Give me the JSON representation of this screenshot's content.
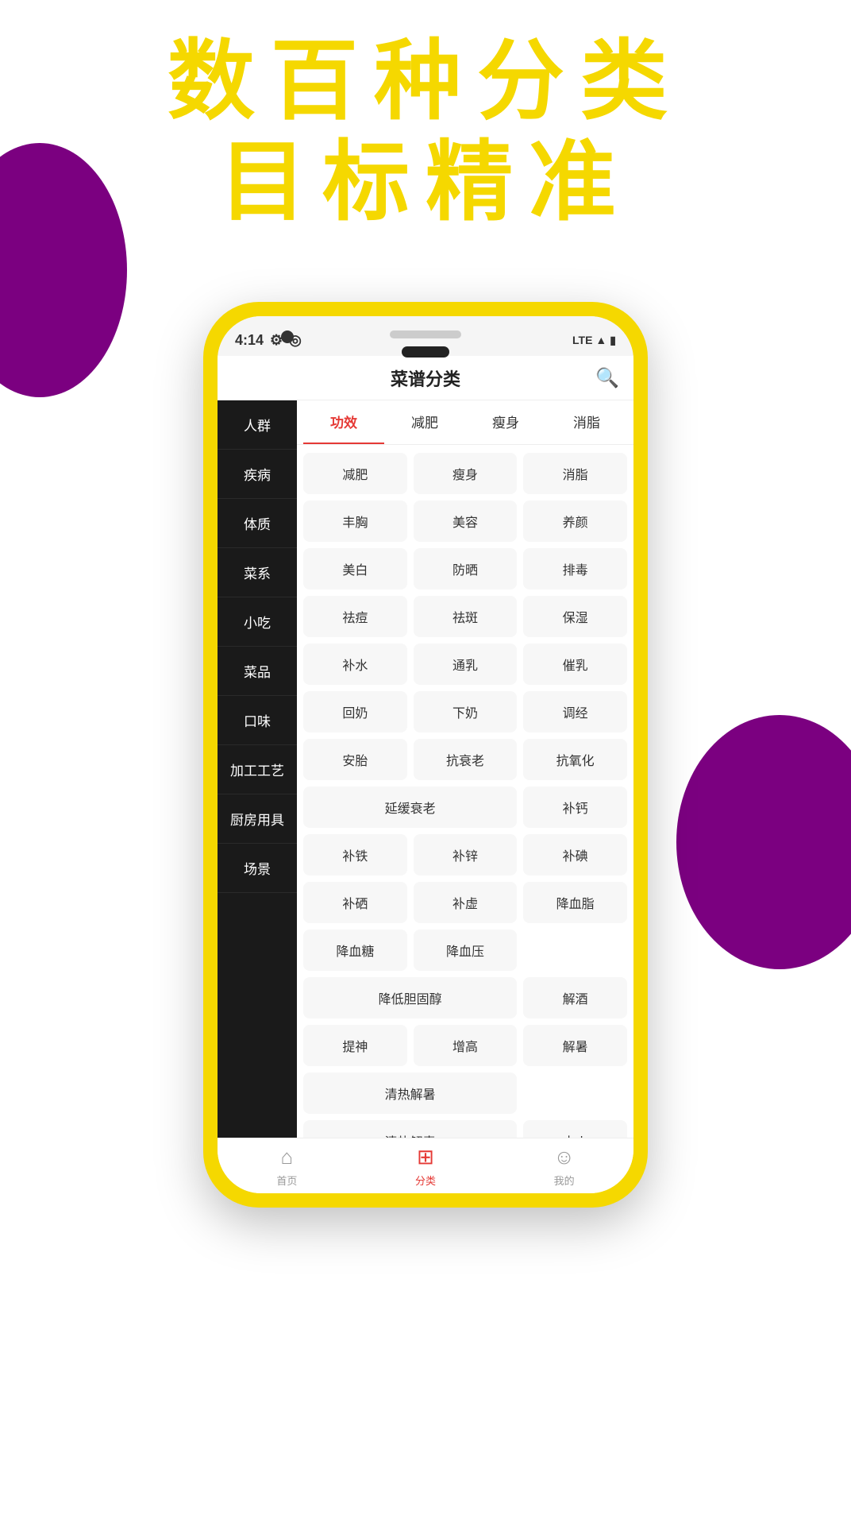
{
  "hero": {
    "line1": "数百种分类",
    "line2": "目标精准"
  },
  "status_bar": {
    "time": "4:14",
    "signal": "LTE",
    "settings_icon": "⚙",
    "location_icon": "◎"
  },
  "header": {
    "title": "菜谱分类",
    "search_label": "搜索"
  },
  "sidebar": {
    "items": [
      {
        "label": "人群",
        "active": false
      },
      {
        "label": "疾病",
        "active": false
      },
      {
        "label": "体质",
        "active": false
      },
      {
        "label": "菜系",
        "active": false
      },
      {
        "label": "小吃",
        "active": false
      },
      {
        "label": "菜品",
        "active": false
      },
      {
        "label": "口味",
        "active": false
      },
      {
        "label": "加工工艺",
        "active": false
      },
      {
        "label": "厨房用具",
        "active": false
      },
      {
        "label": "场景",
        "active": false
      }
    ]
  },
  "top_tabs": [
    {
      "label": "功效",
      "active": true
    },
    {
      "label": "减肥",
      "active": false
    },
    {
      "label": "瘦身",
      "active": false
    },
    {
      "label": "消脂",
      "active": false
    }
  ],
  "tags": [
    {
      "label": "减肥",
      "wide": false
    },
    {
      "label": "瘦身",
      "wide": false
    },
    {
      "label": "消脂",
      "wide": false
    },
    {
      "label": "丰胸",
      "wide": false
    },
    {
      "label": "美容",
      "wide": false
    },
    {
      "label": "养颜",
      "wide": false
    },
    {
      "label": "美白",
      "wide": false
    },
    {
      "label": "防晒",
      "wide": false
    },
    {
      "label": "排毒",
      "wide": false
    },
    {
      "label": "祛痘",
      "wide": false
    },
    {
      "label": "祛斑",
      "wide": false
    },
    {
      "label": "保湿",
      "wide": false
    },
    {
      "label": "补水",
      "wide": false
    },
    {
      "label": "通乳",
      "wide": false
    },
    {
      "label": "催乳",
      "wide": false
    },
    {
      "label": "回奶",
      "wide": false
    },
    {
      "label": "下奶",
      "wide": false
    },
    {
      "label": "调经",
      "wide": false
    },
    {
      "label": "安胎",
      "wide": false
    },
    {
      "label": "抗衰老",
      "wide": false
    },
    {
      "label": "抗氧化",
      "wide": false
    },
    {
      "label": "延缓衰老",
      "wide": false
    },
    {
      "label": "补钙",
      "wide": false
    },
    {
      "label": "补铁",
      "wide": false
    },
    {
      "label": "补锌",
      "wide": false
    },
    {
      "label": "补碘",
      "wide": false
    },
    {
      "label": "补硒",
      "wide": false
    },
    {
      "label": "补虚",
      "wide": false
    },
    {
      "label": "降血脂",
      "wide": false
    },
    {
      "label": "降血糖",
      "wide": false
    },
    {
      "label": "降血压",
      "wide": false
    },
    {
      "label": "降低胆固醇",
      "wide": false
    },
    {
      "label": "解酒",
      "wide": false
    },
    {
      "label": "提神",
      "wide": false
    },
    {
      "label": "增高",
      "wide": false
    },
    {
      "label": "解暑",
      "wide": false
    },
    {
      "label": "清热解暑",
      "wide": false
    },
    {
      "label": "清热解毒",
      "wide": false
    },
    {
      "label": "去火",
      "wide": false
    }
  ],
  "bottom_nav": {
    "items": [
      {
        "label": "首页",
        "icon": "⌂",
        "active": false
      },
      {
        "label": "分类",
        "icon": "⊞",
        "active": true
      },
      {
        "label": "我的",
        "icon": "☺",
        "active": false
      }
    ]
  },
  "colors": {
    "accent_yellow": "#f5d800",
    "accent_red": "#e53935",
    "purple": "#7b0080",
    "sidebar_bg": "#1a1a1a",
    "white": "#ffffff"
  }
}
